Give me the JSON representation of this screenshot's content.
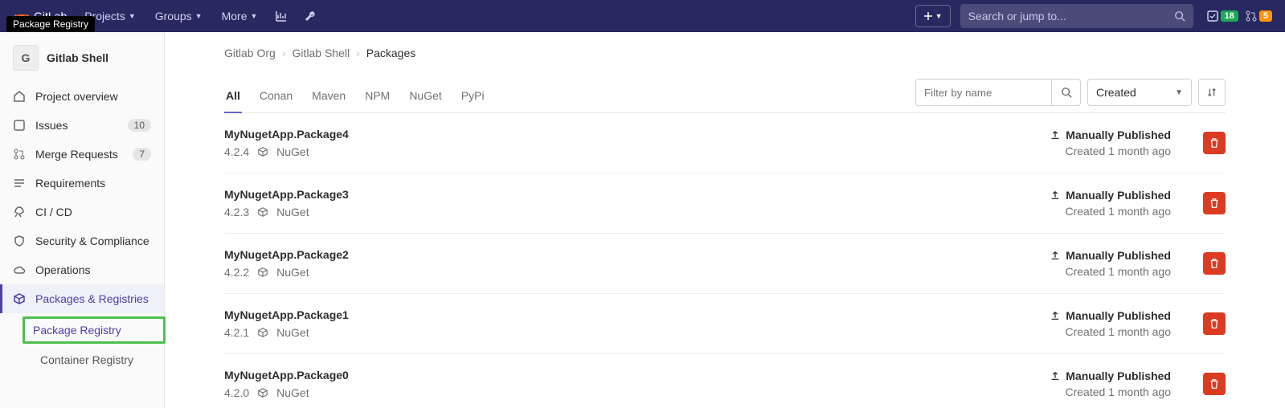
{
  "tooltip": "Package Registry",
  "header": {
    "brand": "GitLab",
    "nav": [
      "Projects",
      "Groups",
      "More"
    ],
    "search_placeholder": "Search or jump to...",
    "todo_count": "18",
    "mr_count": "5"
  },
  "sidebar": {
    "project_initial": "G",
    "project_name": "Gitlab Shell",
    "items": [
      {
        "label": "Project overview"
      },
      {
        "label": "Issues",
        "count": "10"
      },
      {
        "label": "Merge Requests",
        "count": "7"
      },
      {
        "label": "Requirements"
      },
      {
        "label": "CI / CD"
      },
      {
        "label": "Security & Compliance"
      },
      {
        "label": "Operations"
      },
      {
        "label": "Packages & Registries",
        "active": true
      }
    ],
    "sub": [
      {
        "label": "Package Registry"
      },
      {
        "label": "Container Registry"
      }
    ]
  },
  "breadcrumbs": [
    "Gitlab Org",
    "Gitlab Shell",
    "Packages"
  ],
  "tabs": [
    "All",
    "Conan",
    "Maven",
    "NPM",
    "NuGet",
    "PyPi"
  ],
  "filter_placeholder": "Filter by name",
  "sort_label": "Created",
  "packages": [
    {
      "name": "MyNugetApp.Package4",
      "version": "4.2.4",
      "type": "NuGet",
      "publish": "Manually Published",
      "created": "Created 1 month ago"
    },
    {
      "name": "MyNugetApp.Package3",
      "version": "4.2.3",
      "type": "NuGet",
      "publish": "Manually Published",
      "created": "Created 1 month ago"
    },
    {
      "name": "MyNugetApp.Package2",
      "version": "4.2.2",
      "type": "NuGet",
      "publish": "Manually Published",
      "created": "Created 1 month ago"
    },
    {
      "name": "MyNugetApp.Package1",
      "version": "4.2.1",
      "type": "NuGet",
      "publish": "Manually Published",
      "created": "Created 1 month ago"
    },
    {
      "name": "MyNugetApp.Package0",
      "version": "4.2.0",
      "type": "NuGet",
      "publish": "Manually Published",
      "created": "Created 1 month ago"
    }
  ]
}
